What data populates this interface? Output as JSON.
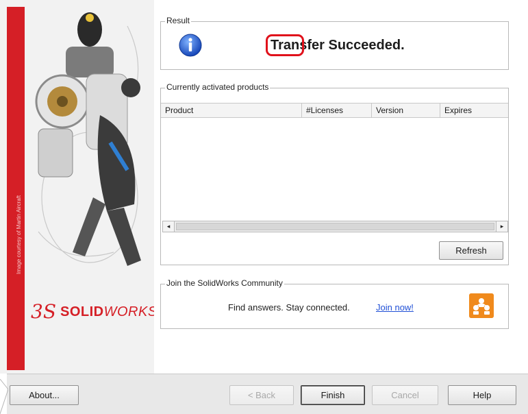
{
  "left_panel": {
    "image_credit": "Image courtesy of Martin Aircraft",
    "logo": {
      "mark": "3S",
      "brand_bold": "SOLID",
      "brand_italic": "WORKS"
    }
  },
  "result": {
    "title": "Result",
    "message": "Transfer Succeeded.",
    "icon": "info-icon"
  },
  "products": {
    "title": "Currently activated products",
    "columns": [
      "Product",
      "#Licenses",
      "Version",
      "Expires"
    ],
    "rows": [],
    "scroll_left": "◂",
    "scroll_right": "▸",
    "refresh_label": "Refresh"
  },
  "community": {
    "title": "Join the SolidWorks Community",
    "tagline": "Find answers. Stay connected.",
    "link_label": "Join now!",
    "icon": "community-icon"
  },
  "footer": {
    "about_label": "About...",
    "back_label": "< Back",
    "finish_label": "Finish",
    "cancel_label": "Cancel",
    "help_label": "Help"
  },
  "colors": {
    "brand_red": "#d51f26",
    "highlight_red": "#e0111b",
    "link_blue": "#1f4fd6",
    "community_orange": "#f08a1c"
  }
}
